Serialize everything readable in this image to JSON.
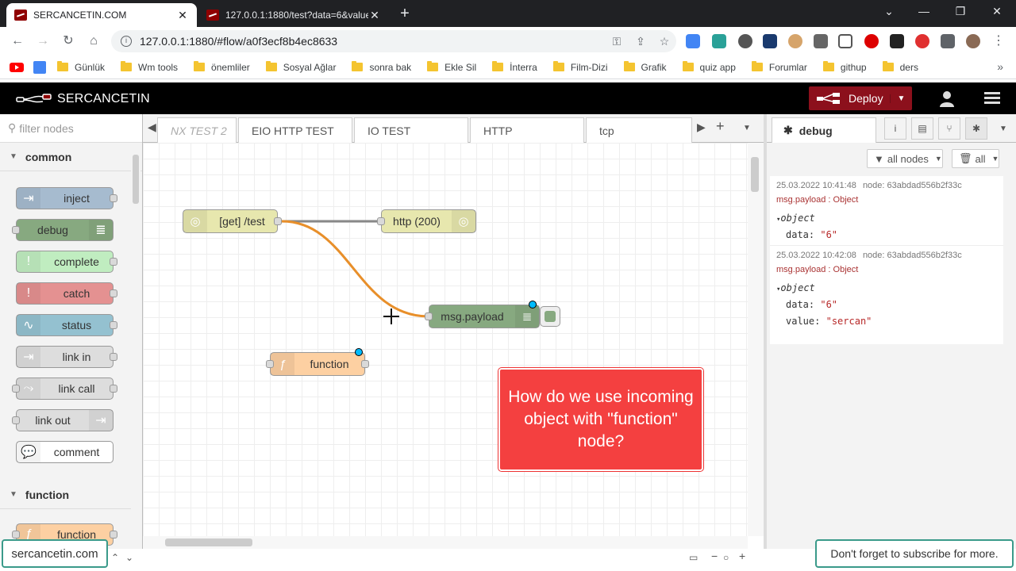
{
  "browser": {
    "tabs": [
      {
        "title": "SERCANCETIN.COM"
      },
      {
        "title": "127.0.0.1:1880/test?data=6&value"
      }
    ],
    "url": "127.0.0.1:1880/#flow/a0f3ecf8b4ec8633",
    "bookmarks": [
      "Günlük",
      "Wm tools",
      "önemliler",
      "Sosyal Ağlar",
      "sonra bak",
      "Ekle Sil",
      "İnterra",
      "Film-Dizi",
      "Grafik",
      "quiz app",
      "Forumlar",
      "githup",
      "ders"
    ]
  },
  "header": {
    "title": "SERCANCETIN",
    "deploy_label": "Deploy"
  },
  "palette": {
    "filter_placeholder": "filter nodes",
    "category_common": "common",
    "category_function": "function",
    "nodes": [
      "inject",
      "debug",
      "complete",
      "catch",
      "status",
      "link in",
      "link call",
      "link out",
      "comment",
      "function"
    ]
  },
  "workspace": {
    "tabs": [
      "NX TEST 2",
      "EIO HTTP TEST",
      "IO TEST",
      "HTTP",
      "tcp"
    ],
    "nodes": {
      "get_test": "[get] /test",
      "http_200": "http (200)",
      "msg_payload": "msg.payload",
      "function": "function"
    },
    "callout": "How do we use incoming object with \"function\" node?"
  },
  "sidebar": {
    "tab_debug": "debug",
    "filter_nodes": "all nodes",
    "clear_all": "all",
    "messages": [
      {
        "time": "25.03.2022 10:41:48",
        "node": "node: 63abdad556b2f33c",
        "topic": "msg.payload : Object",
        "type": "object",
        "rows": [
          {
            "key": "data:",
            "val": "\"6\""
          }
        ]
      },
      {
        "time": "25.03.2022 10:42:08",
        "node": "node: 63abdad556b2f33c",
        "topic": "msg.payload : Object",
        "type": "object",
        "rows": [
          {
            "key": "data:",
            "val": "\"6\""
          },
          {
            "key": "value:",
            "val": "\"sercan\""
          }
        ]
      }
    ]
  },
  "overlays": {
    "left": "sercancetin.com",
    "right": "Don't forget to subscribe for more."
  },
  "colors": {
    "deploy": "#8c101c",
    "callout": "#f44040",
    "wire_active": "#e88f2a"
  }
}
